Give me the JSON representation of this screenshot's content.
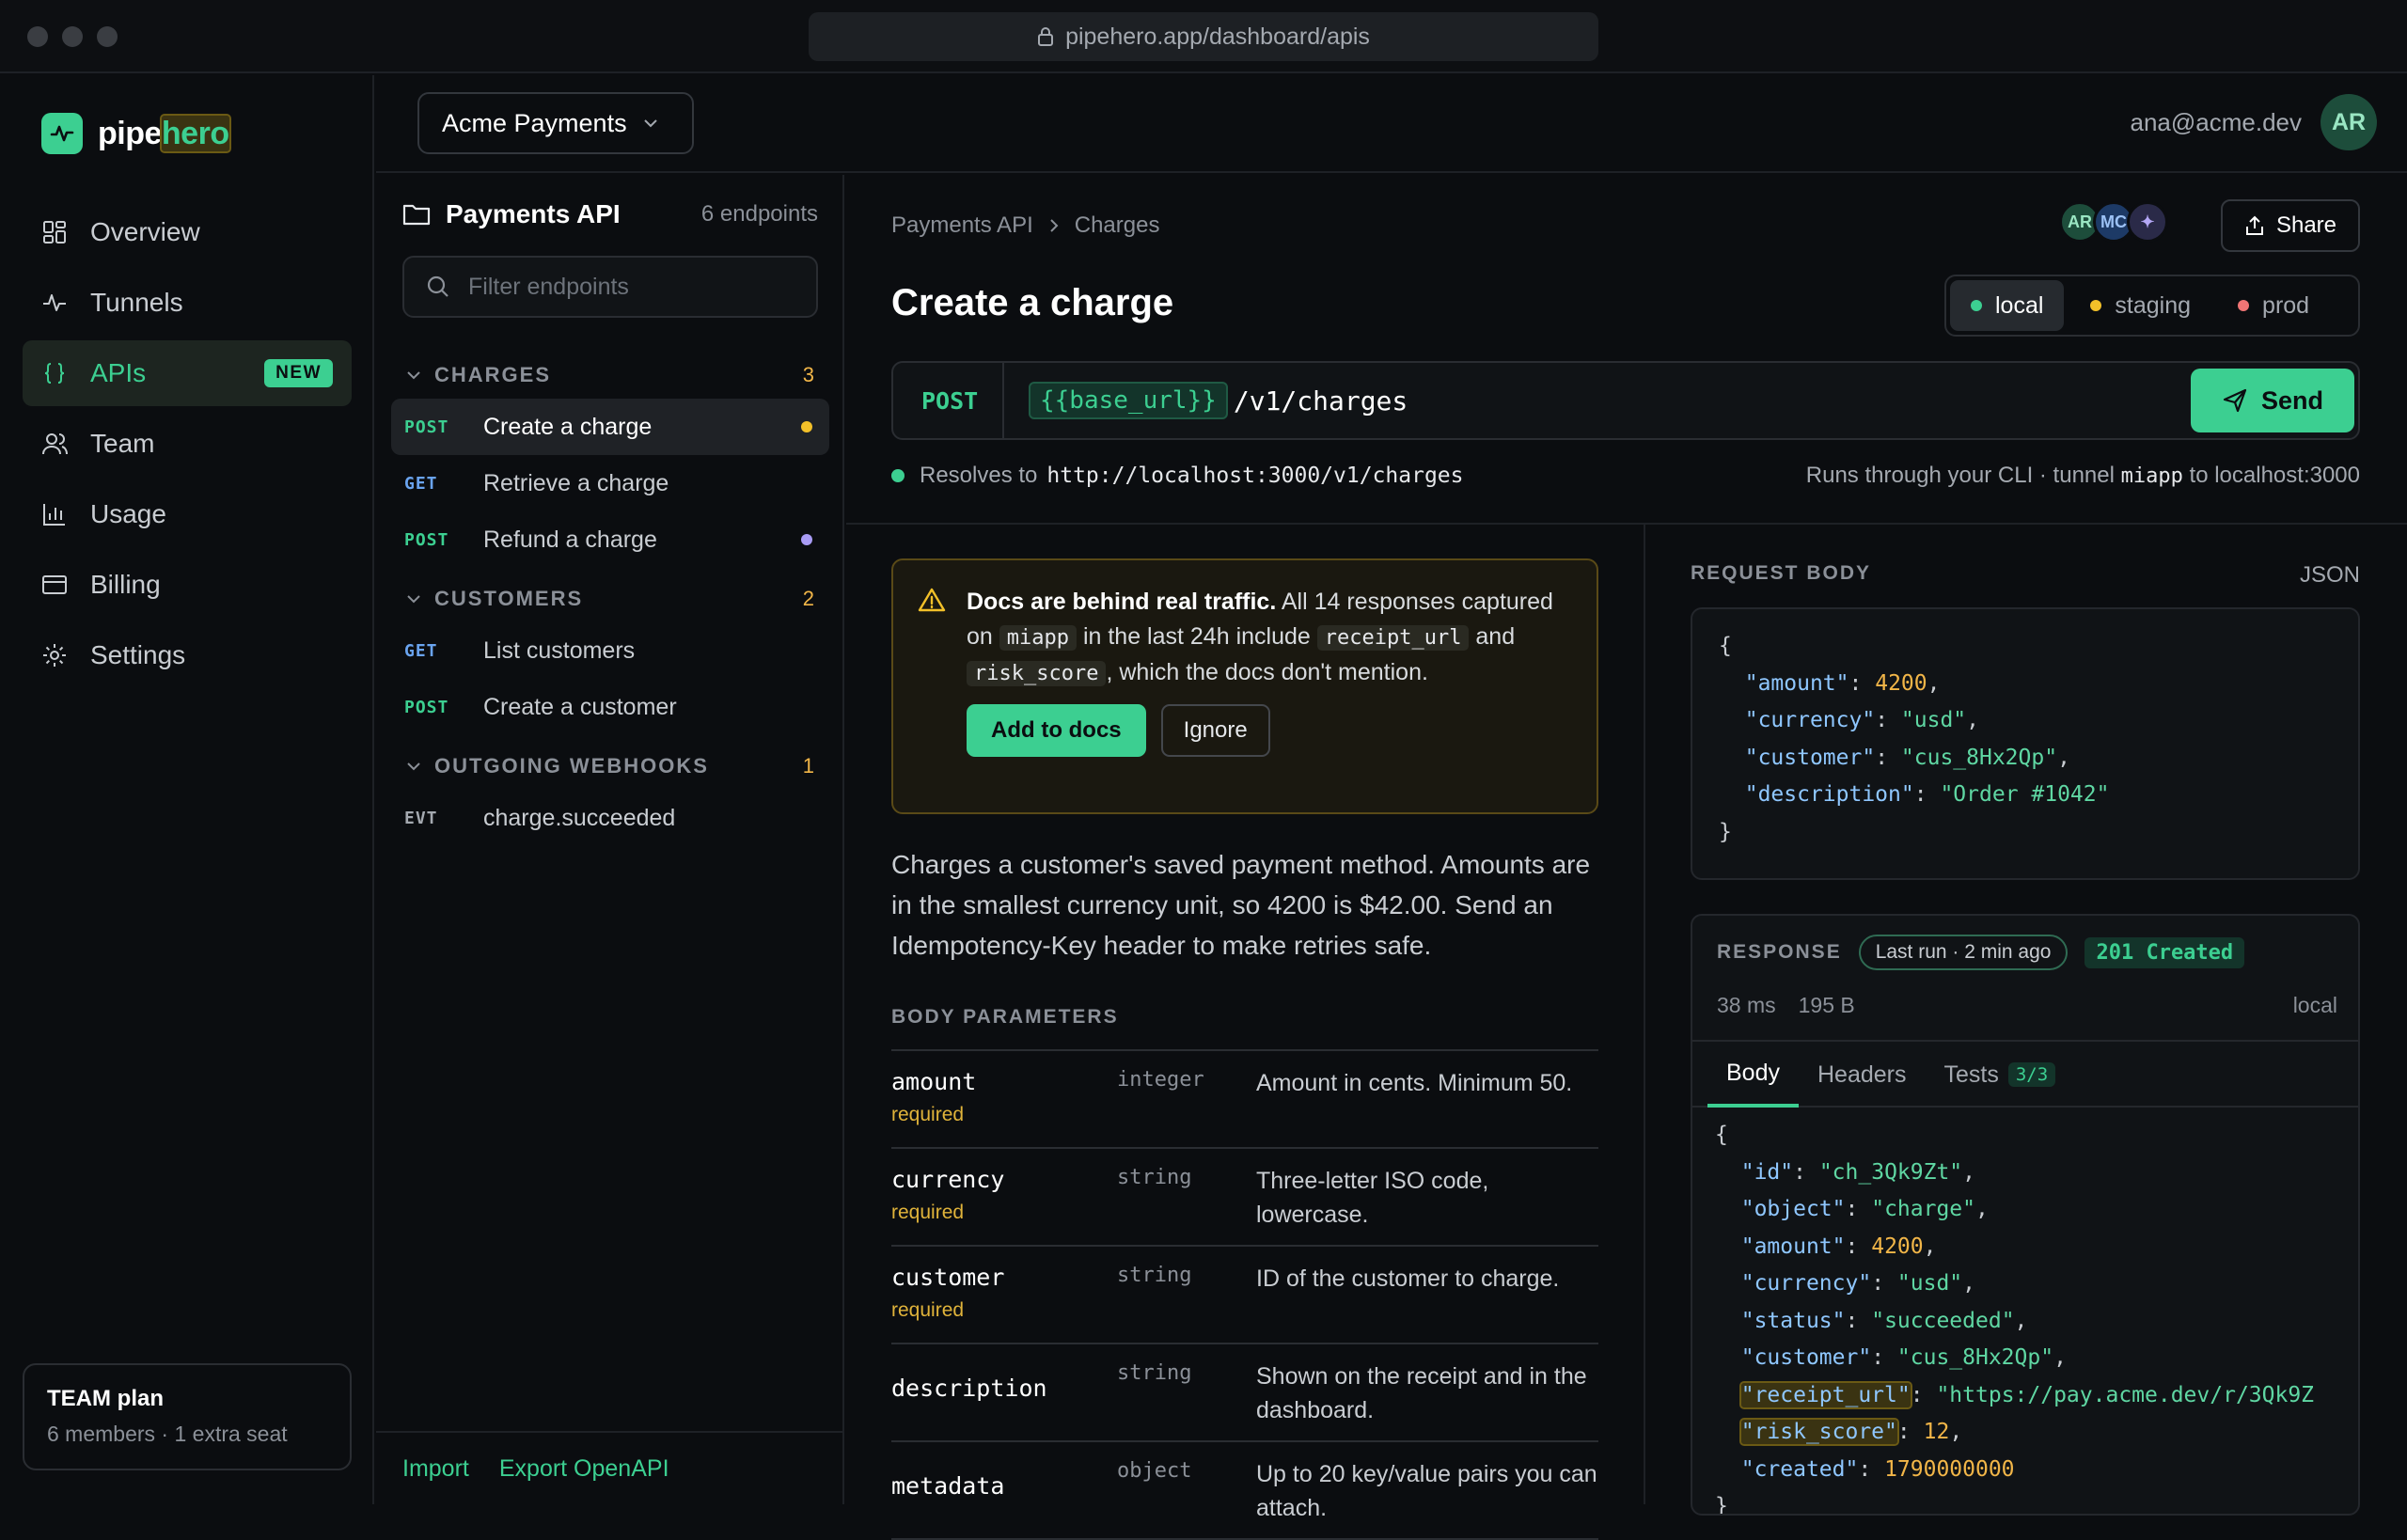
{
  "browser": {
    "url": "pipehero.app/dashboard/apis"
  },
  "brand": {
    "name_a": "pipe",
    "name_b": "hero"
  },
  "nav": [
    {
      "label": "Overview",
      "icon": "grid-icon"
    },
    {
      "label": "Tunnels",
      "icon": "pulse-icon"
    },
    {
      "label": "APIs",
      "icon": "braces-icon",
      "badge": "NEW",
      "active": true
    },
    {
      "label": "Team",
      "icon": "users-icon"
    },
    {
      "label": "Usage",
      "icon": "bar-chart-icon"
    },
    {
      "label": "Billing",
      "icon": "card-icon"
    },
    {
      "label": "Settings",
      "icon": "gear-icon"
    }
  ],
  "plan": {
    "title": "TEAM plan",
    "sub": "6 members · 1 extra seat"
  },
  "workspace": {
    "name": "Acme Payments"
  },
  "user": {
    "email": "ana@acme.dev",
    "initials": "AR"
  },
  "endpoints": {
    "title": "Payments API",
    "count": "6 endpoints",
    "filter_placeholder": "Filter endpoints",
    "groups": [
      {
        "name": "CHARGES",
        "count": "3",
        "items": [
          {
            "method": "POST",
            "label": "Create a charge",
            "active": true,
            "dot": "#f2c029"
          },
          {
            "method": "GET",
            "label": "Retrieve a charge"
          },
          {
            "method": "POST",
            "label": "Refund a charge",
            "dot": "#a99cf5"
          }
        ]
      },
      {
        "name": "CUSTOMERS",
        "count": "2",
        "items": [
          {
            "method": "GET",
            "label": "List customers"
          },
          {
            "method": "POST",
            "label": "Create a customer"
          }
        ]
      },
      {
        "name": "OUTGOING WEBHOOKS",
        "count": "1",
        "items": [
          {
            "method": "EVT",
            "label": "charge.succeeded"
          }
        ]
      }
    ],
    "footer": {
      "import": "Import",
      "export": "Export OpenAPI"
    }
  },
  "main": {
    "breadcrumb": [
      "Payments API",
      "Charges"
    ],
    "collaborators": [
      "AR",
      "MC",
      "✦"
    ],
    "share": "Share",
    "title": "Create a charge",
    "envs": [
      {
        "label": "local",
        "color": "#3ccf91",
        "active": true
      },
      {
        "label": "staging",
        "color": "#f2c029"
      },
      {
        "label": "prod",
        "color": "#f07575"
      }
    ],
    "request": {
      "method": "POST",
      "variable": "{{base_url}}",
      "path": "/v1/charges",
      "send": "Send"
    },
    "resolve": {
      "prefix": "Resolves to",
      "url": "http://localhost:3000/v1/charges",
      "right_a": "Runs through your CLI · tunnel",
      "tunnel": "miapp",
      "right_b": "to localhost:3000"
    },
    "alert": {
      "bold": "Docs are behind real traffic.",
      "text1": "All 14 responses captured on",
      "code1": "miapp",
      "text2": "in the last 24h include",
      "code2": "receipt_url",
      "text3": "and",
      "code3": "risk_score",
      "text4": ", which the docs don't mention.",
      "primary": "Add to docs",
      "secondary": "Ignore"
    },
    "description": "Charges a customer's saved payment method. Amounts are in the smallest currency unit, so 4200 is $42.00. Send an Idempotency-Key header to make retries safe.",
    "body_params_title": "BODY PARAMETERS",
    "params": [
      {
        "name": "amount",
        "required": "required",
        "type": "integer",
        "desc": "Amount in cents. Minimum 50."
      },
      {
        "name": "currency",
        "required": "required",
        "type": "string",
        "desc": "Three-letter ISO code, lowercase."
      },
      {
        "name": "customer",
        "required": "required",
        "type": "string",
        "desc": "ID of the customer to charge."
      },
      {
        "name": "description",
        "required": "",
        "type": "string",
        "desc": "Shown on the receipt and in the dashboard."
      },
      {
        "name": "metadata",
        "required": "",
        "type": "object",
        "desc": "Up to 20 key/value pairs you can attach."
      }
    ],
    "request_body": {
      "title": "REQUEST BODY",
      "format": "JSON",
      "fields": [
        {
          "key": "amount",
          "value": "4200",
          "kind": "n"
        },
        {
          "key": "currency",
          "value": "\"usd\"",
          "kind": "s"
        },
        {
          "key": "customer",
          "value": "\"cus_8Hx2Qp\"",
          "kind": "s"
        },
        {
          "key": "description",
          "value": "\"Order #1042\"",
          "kind": "s"
        }
      ]
    },
    "response": {
      "title": "RESPONSE",
      "last_run": "Last run · 2 min ago",
      "status": "201 Created",
      "time": "38 ms",
      "size": "195 B",
      "env": "local",
      "tabs": [
        {
          "label": "Body",
          "active": true
        },
        {
          "label": "Headers"
        },
        {
          "label": "Tests",
          "count": "3/3"
        }
      ],
      "fields": [
        {
          "key": "id",
          "value": "\"ch_3Qk9Zt\"",
          "kind": "s"
        },
        {
          "key": "object",
          "value": "\"charge\"",
          "kind": "s"
        },
        {
          "key": "amount",
          "value": "4200",
          "kind": "n"
        },
        {
          "key": "currency",
          "value": "\"usd\"",
          "kind": "s"
        },
        {
          "key": "status",
          "value": "\"succeeded\"",
          "kind": "s"
        },
        {
          "key": "customer",
          "value": "\"cus_8Hx2Qp\"",
          "kind": "s"
        },
        {
          "key": "receipt_url",
          "value": "\"https://pay.acme.dev/r/3Qk9Z",
          "kind": "s",
          "highlight": true
        },
        {
          "key": "risk_score",
          "value": "12",
          "kind": "n",
          "highlight": true
        },
        {
          "key": "created",
          "value": "1790000000",
          "kind": "n"
        }
      ]
    }
  },
  "colors": {
    "accent": "#3ccf91",
    "warning": "#f2c029",
    "danger": "#f07575",
    "background": "#0b0d10"
  }
}
